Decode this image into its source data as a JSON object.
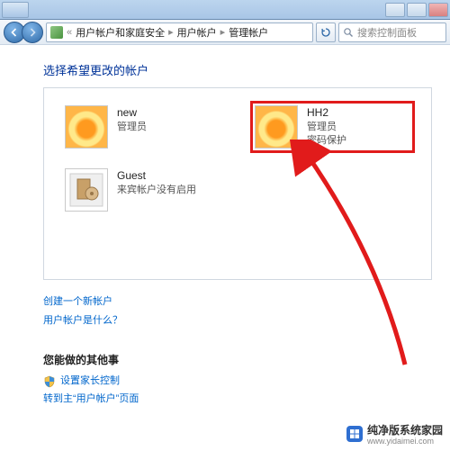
{
  "breadcrumb": {
    "seg1": "用户帐户和家庭安全",
    "seg2": "用户帐户",
    "seg3": "管理帐户"
  },
  "search": {
    "placeholder": "搜索控制面板"
  },
  "heading": "选择希望更改的帐户",
  "accounts": {
    "a1": {
      "name": "new",
      "desc": "管理员"
    },
    "a2": {
      "name": "HH2",
      "desc1": "管理员",
      "desc2": "密码保护"
    },
    "a3": {
      "name": "Guest",
      "desc": "来宾帐户没有启用"
    }
  },
  "links": {
    "create": "创建一个新帐户",
    "what": "用户帐户是什么？"
  },
  "other": {
    "title": "您能做的其他事",
    "parental": "设置家长控制",
    "goto": "转到主“用户帐户”页面"
  },
  "footer": {
    "line1": "纯净版系统家园",
    "line2": "www.yidaimei.com"
  }
}
